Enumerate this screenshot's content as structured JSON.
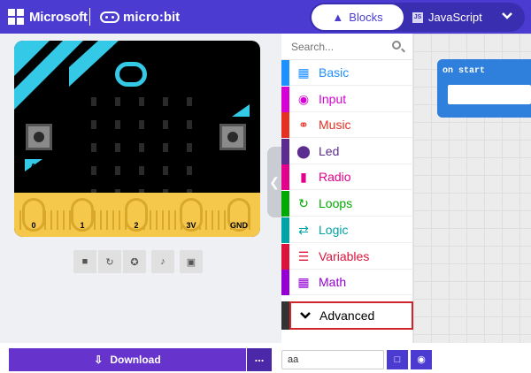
{
  "header": {
    "brand": "Microsoft",
    "product": "micro:bit",
    "tabs": [
      {
        "label": "Blocks",
        "active": true
      },
      {
        "label": "JavaScript",
        "active": false
      }
    ],
    "accent": "#4b3bd1"
  },
  "simulator": {
    "pins": [
      "0",
      "1",
      "2",
      "3V",
      "GND"
    ],
    "button_a": "A",
    "button_b": "B",
    "controls": [
      "stop-icon",
      "restart-icon",
      "debug-icon",
      "mute-icon",
      "fullscreen-icon"
    ]
  },
  "toolbox": {
    "search_placeholder": "Search...",
    "categories": [
      {
        "label": "Basic",
        "color": "#1e90ff",
        "icon": "grid-icon"
      },
      {
        "label": "Input",
        "color": "#d400d4",
        "icon": "input-icon"
      },
      {
        "label": "Music",
        "color": "#e63022",
        "icon": "headphones-icon"
      },
      {
        "label": "Led",
        "color": "#5c2d91",
        "icon": "toggle-icon"
      },
      {
        "label": "Radio",
        "color": "#e3008c",
        "icon": "signal-icon"
      },
      {
        "label": "Loops",
        "color": "#00aa00",
        "icon": "refresh-icon"
      },
      {
        "label": "Logic",
        "color": "#00a4a6",
        "icon": "shuffle-icon"
      },
      {
        "label": "Variables",
        "color": "#dc143c",
        "icon": "list-icon"
      },
      {
        "label": "Math",
        "color": "#9400d3",
        "icon": "calculator-icon"
      }
    ],
    "advanced_label": "Advanced"
  },
  "workspace": {
    "block_label": "on start",
    "block_color": "#2f7fdc"
  },
  "footer": {
    "download_label": "Download",
    "more_label": "...",
    "project_name": "aa"
  }
}
